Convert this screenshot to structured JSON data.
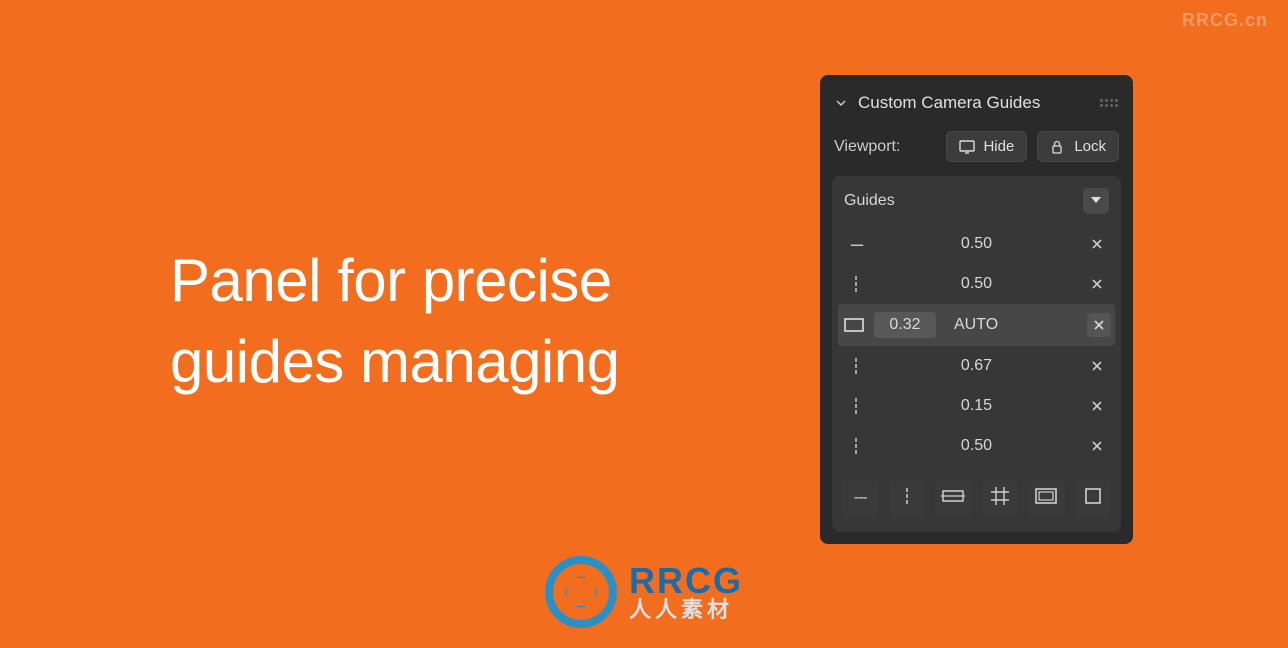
{
  "watermark": "RRCG.cn",
  "headline_line1": "Panel for precise",
  "headline_line2": "guides managing",
  "logo": {
    "top": "RRCG",
    "bottom": "人人素材"
  },
  "panel": {
    "title": "Custom Camera Guides",
    "viewport": {
      "label": "Viewport:",
      "hide": "Hide",
      "lock": "Lock"
    },
    "guides_label": "Guides",
    "rows": [
      {
        "type": "h-dash",
        "value": "0.50",
        "auto": "",
        "highlighted": false
      },
      {
        "type": "v-dash",
        "value": "0.50",
        "auto": "",
        "highlighted": false
      },
      {
        "type": "rect",
        "value": "0.32",
        "auto": "AUTO",
        "highlighted": true
      },
      {
        "type": "v-dash",
        "value": "0.67",
        "auto": "",
        "highlighted": false
      },
      {
        "type": "v-dash",
        "value": "0.15",
        "auto": "",
        "highlighted": false
      },
      {
        "type": "v-dash",
        "value": "0.50",
        "auto": "",
        "highlighted": false
      }
    ]
  }
}
